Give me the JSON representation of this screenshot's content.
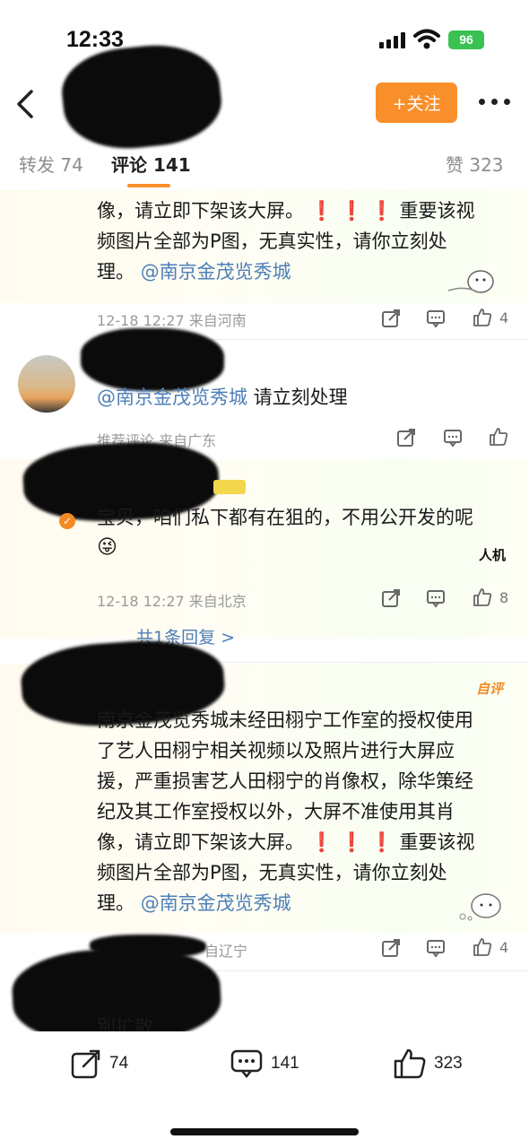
{
  "status_bar": {
    "time": "12:33",
    "battery": "96"
  },
  "nav": {
    "follow_label": "+关注"
  },
  "tabs": [
    {
      "label": "转发 74"
    },
    {
      "label": "评论 141"
    },
    {
      "label": "赞 323"
    }
  ],
  "comment1": {
    "lines": [
      "像，请立即下架该大屏。",
      "频图片全部为P图，无真实性，请你立刻处",
      "理。"
    ],
    "emphasis": "重要该视",
    "mention": "@南京金茂览秀城",
    "meta": "12-18 12:27 来自河南",
    "likes": "4"
  },
  "comment2": {
    "mention": "@南京金茂览秀城",
    "text": " 请立刻处理",
    "meta": "推荐评论 来自广东"
  },
  "comment3": {
    "text": "宝贝，咱们私下都有在狙的，不用公开发的呢",
    "meta": "12-18 12:27 来自北京",
    "likes": "8",
    "reply_link": "共1条回复 >",
    "watermark": "人机"
  },
  "comment4": {
    "tag": "自评",
    "lines": [
      "南京金茂览秀城未经田栩宁工作室的授权使用",
      "了艺人田栩宁相关视频以及照片进行大屏应",
      "援，严重损害艺人田栩宁的肖像权，除华策经",
      "纪及其工作室授权以外，大屏不准使用其肖",
      "像，请立即下架该大屏。",
      "频图片全部为P图，无真实性，请你立刻处",
      "理。"
    ],
    "emphasis": "重要该视",
    "mention": "@南京金茂览秀城",
    "meta": "自辽宁",
    "likes": "4"
  },
  "comment5": {
    "text": "別扩散"
  },
  "bottom_bar": {
    "repost_count": "74",
    "comment_count": "141",
    "like_count": "323"
  }
}
